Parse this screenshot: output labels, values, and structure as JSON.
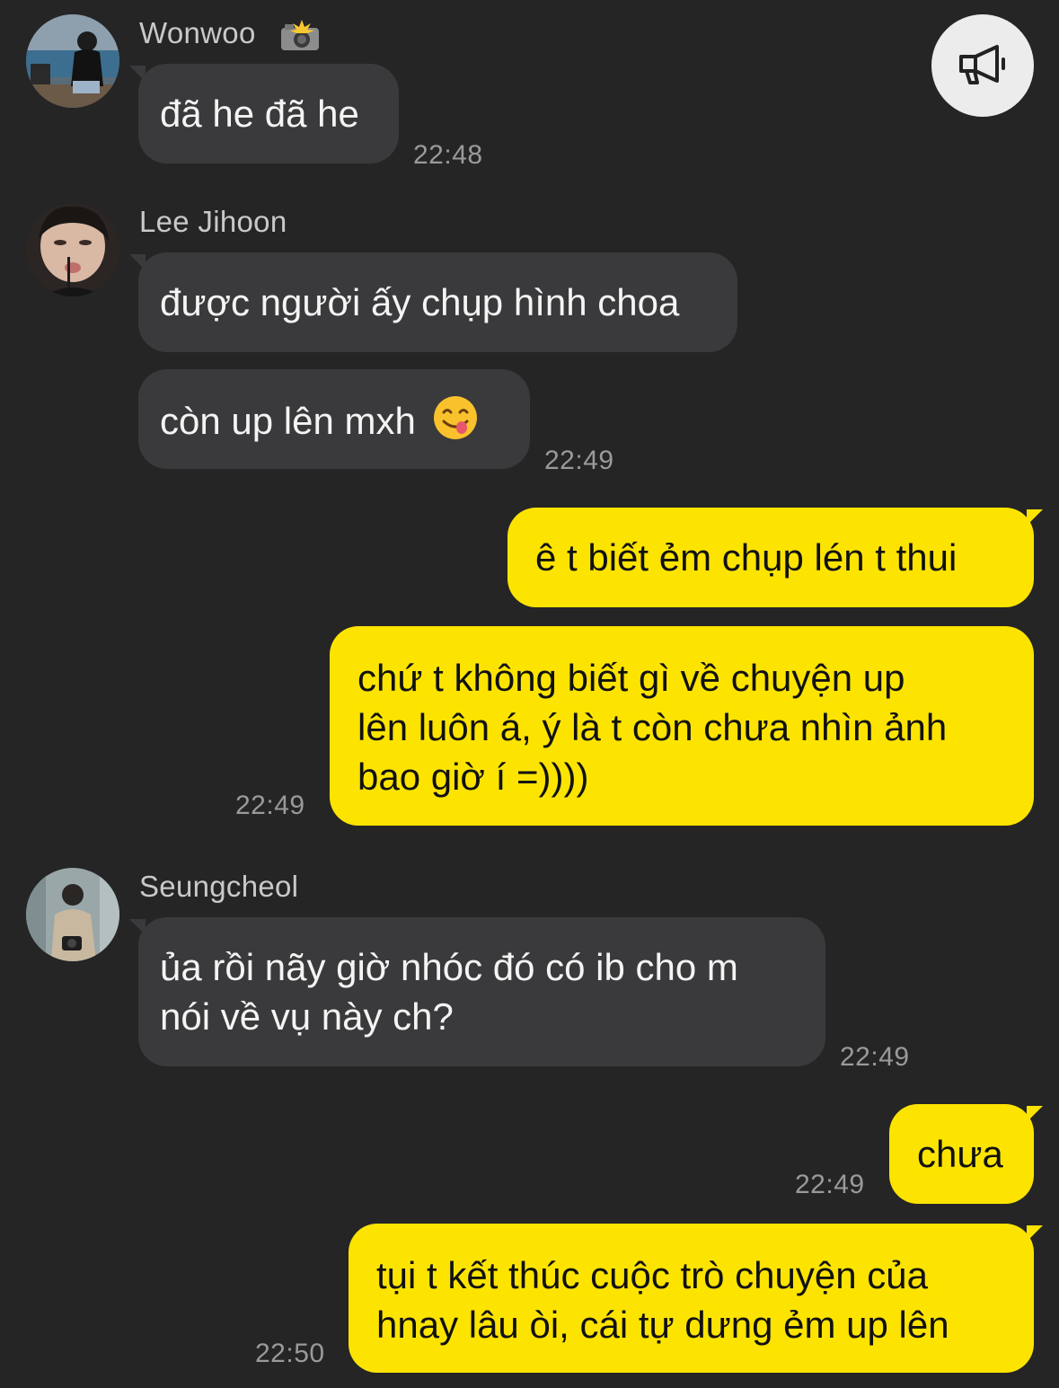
{
  "announce": {
    "icon": "megaphone-icon"
  },
  "messages": [
    {
      "sender": "Wonwoo",
      "badge": "📸",
      "text": "đã he đã he",
      "time": "22:48"
    },
    {
      "sender": "Lee Jihoon",
      "text": "được người ấy chụp hình choa"
    },
    {
      "text": "còn up lên mxh",
      "emoji": "😋",
      "time": "22:49"
    },
    {
      "self": true,
      "text": "ê t biết ẻm chụp lén t thui"
    },
    {
      "self": true,
      "lines": [
        "chứ t không biết gì về chuyện up",
        "lên luôn á, ý là t còn chưa nhìn ảnh",
        "bao giờ í =))))"
      ],
      "time": "22:49"
    },
    {
      "sender": "Seungcheol",
      "lines": [
        "ủa rồi nãy giờ nhóc đó có ib cho m",
        "nói về vụ này ch?"
      ],
      "time": "22:49"
    },
    {
      "self": true,
      "text": "chưa",
      "time": "22:49"
    },
    {
      "self": true,
      "lines": [
        "tụi t kết thúc cuộc trò chuyện của",
        "hnay lâu òi, cái tự dưng ẻm up lên"
      ],
      "time": "22:50"
    }
  ],
  "colors": {
    "background": "#252526",
    "incoming_bubble": "#3a3a3c",
    "outgoing_bubble": "#fde400"
  }
}
